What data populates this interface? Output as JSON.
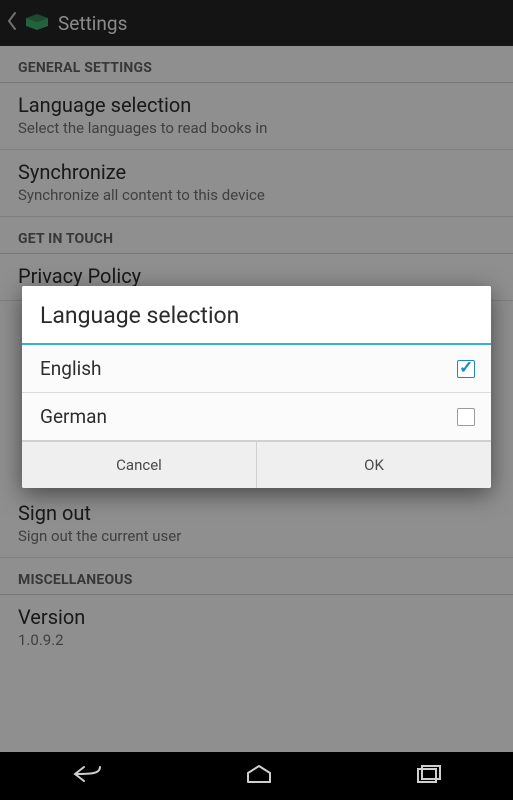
{
  "actionBar": {
    "title": "Settings"
  },
  "sections": {
    "general": {
      "header": "GENERAL SETTINGS",
      "language": {
        "title": "Language selection",
        "sub": "Select the languages to read books in"
      },
      "sync": {
        "title": "Synchronize",
        "sub": "Synchronize all content to this device"
      }
    },
    "getInTouch": {
      "header": "GET IN TOUCH",
      "privacy": {
        "title": "Privacy Policy"
      }
    },
    "signOut": {
      "title": "Sign out",
      "sub": "Sign out the current user"
    },
    "misc": {
      "header": "MISCELLANEOUS",
      "version": {
        "title": "Version",
        "sub": "1.0.9.2"
      }
    }
  },
  "dialog": {
    "title": "Language selection",
    "options": [
      {
        "label": "English",
        "checked": true
      },
      {
        "label": "German",
        "checked": false
      }
    ],
    "cancel": "Cancel",
    "ok": "OK"
  }
}
